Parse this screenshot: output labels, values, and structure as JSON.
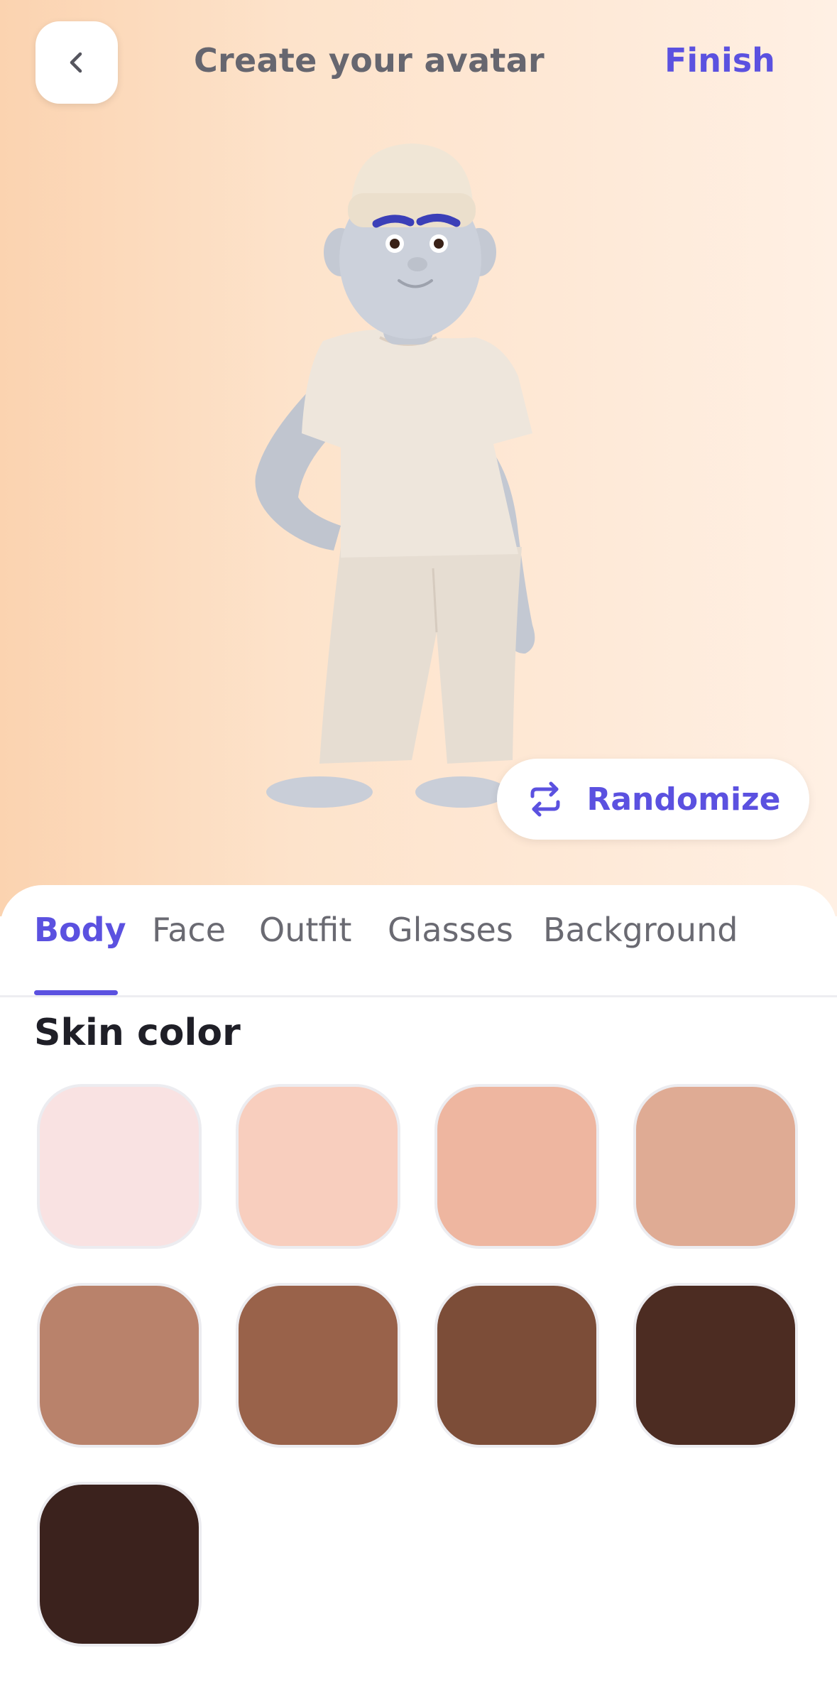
{
  "header": {
    "back_icon": "chevron-left-icon",
    "title": "Create your avatar",
    "finish_label": "Finish"
  },
  "preview": {
    "randomize_label": "Randomize",
    "randomize_icon": "shuffle-arrows-icon"
  },
  "tabs": [
    {
      "label": "Body",
      "active": true
    },
    {
      "label": "Face",
      "active": false
    },
    {
      "label": "Outfit",
      "active": false
    },
    {
      "label": "Glasses",
      "active": false
    },
    {
      "label": "Background",
      "active": false
    }
  ],
  "skin_section": {
    "title": "Skin color",
    "colors": [
      "#f9e2e2",
      "#f8cebe",
      "#eeb6a0",
      "#dfab94",
      "#b9826b",
      "#99624a",
      "#7c4d38",
      "#4c2c22",
      "#3b221d"
    ]
  },
  "accent_color": "#5b51e0"
}
